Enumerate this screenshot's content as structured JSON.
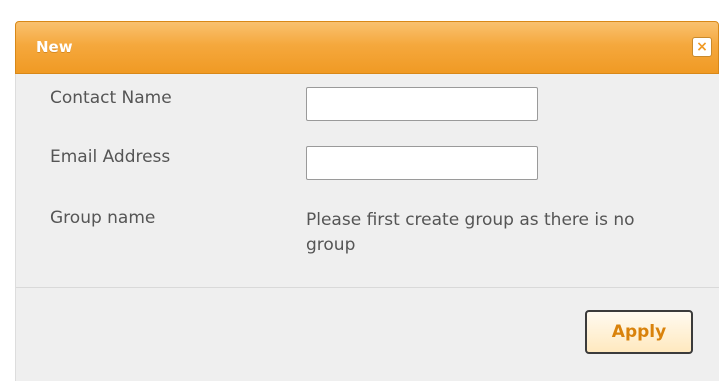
{
  "dialog": {
    "title": "New",
    "close_icon": "close-icon",
    "close_glyph": "×"
  },
  "form": {
    "contact_name_label": "Contact Name",
    "contact_name_value": "",
    "email_label": "Email Address",
    "email_value": "",
    "group_label": "Group name",
    "group_message": "Please first create group as there is no group"
  },
  "actions": {
    "apply_label": "Apply"
  },
  "colors": {
    "title_bar": "#f5a83d",
    "apply_text": "#d9820b",
    "content_bg": "#efefef"
  }
}
